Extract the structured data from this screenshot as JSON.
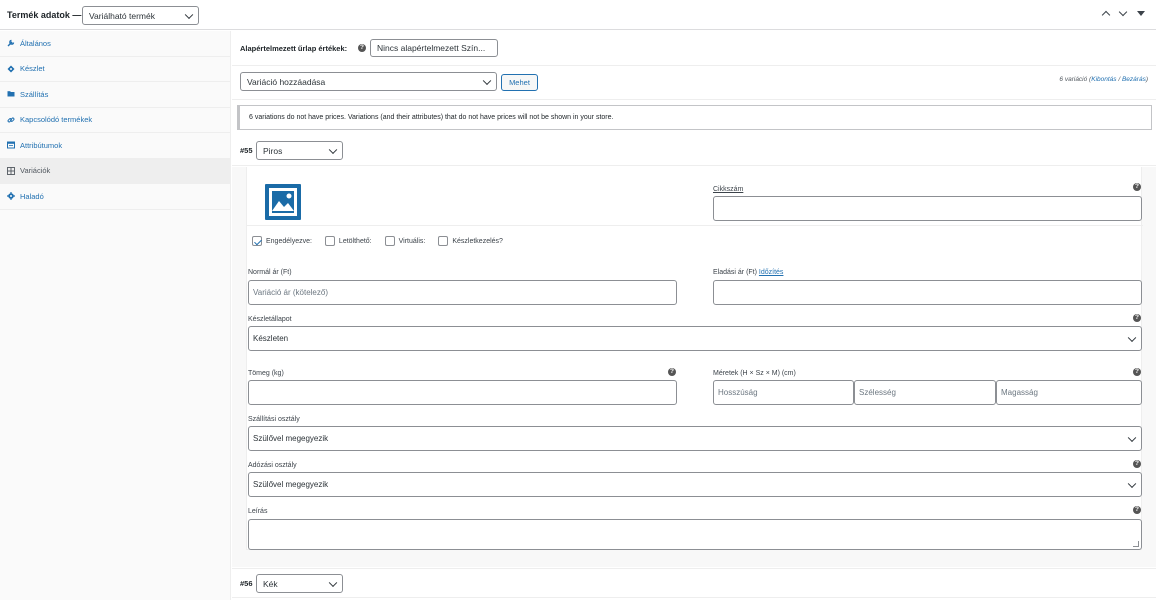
{
  "header": {
    "title": "Termék adatok —",
    "product_type": "Variálható termék"
  },
  "sidebar": {
    "items": [
      {
        "label": "Általános",
        "icon": "wrench-icon"
      },
      {
        "label": "Készlet",
        "icon": "tag-icon"
      },
      {
        "label": "Szállítás",
        "icon": "truck-icon"
      },
      {
        "label": "Kapcsolódó termékek",
        "icon": "link-icon"
      },
      {
        "label": "Attribútumok",
        "icon": "list-icon"
      },
      {
        "label": "Variációk",
        "icon": "grid-icon"
      },
      {
        "label": "Haladó",
        "icon": "gear-icon"
      }
    ],
    "active": "Variációk"
  },
  "defaults": {
    "label": "Alapértelmezett űrlap értékek:",
    "value": "Nincs alapértelmezett Szín..."
  },
  "add_variation": {
    "select_value": "Variáció hozzáadása",
    "go_label": "Mehet",
    "count_text": "6 variáció",
    "expand_label": "Kibontás",
    "separator": "/",
    "close_label": "Bezárás"
  },
  "notice": "6 variations do not have prices. Variations (and their attributes) that do not have prices will not be shown in your store.",
  "variation_55": {
    "number": "#55",
    "color": "Piros",
    "sku_label": "Cikkszám",
    "sku_value": "",
    "checkboxes": [
      {
        "label": "Engedélyezve:",
        "checked": true
      },
      {
        "label": "Letölthető:",
        "checked": false
      },
      {
        "label": "Virtuális:",
        "checked": false
      },
      {
        "label": "Készletkezelés?",
        "checked": false
      }
    ],
    "regular_price_label": "Normál ár (Ft)",
    "regular_price_placeholder": "Variáció ár (kötelező)",
    "sale_price_label": "Eladási ár (Ft)",
    "schedule_link": "Időzítés",
    "stock_status_label": "Készletállapot",
    "stock_status_value": "Készleten",
    "weight_label": "Tömeg (kg)",
    "dimensions_label": "Méretek (H × Sz × M) (cm)",
    "length_placeholder": "Hosszúság",
    "width_placeholder": "Szélesség",
    "height_placeholder": "Magasság",
    "shipping_class_label": "Szállítási osztály",
    "shipping_class_value": "Szülővel megegyezik",
    "tax_class_label": "Adózási osztály",
    "tax_class_value": "Szülővel megegyezik",
    "description_label": "Leírás"
  },
  "variation_56": {
    "number": "#56",
    "color": "Kék"
  },
  "colors": {
    "link": "#2271b1",
    "image_placeholder": "#1a6ba7",
    "border": "#8c8f94"
  }
}
